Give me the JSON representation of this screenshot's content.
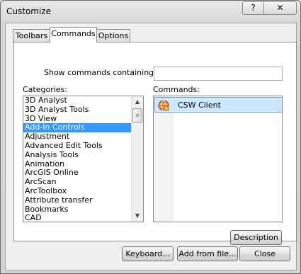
{
  "window": {
    "title": "Customize",
    "help_label": "?",
    "close_label": "✕"
  },
  "tabs": [
    {
      "label": "Toolbars",
      "active": false
    },
    {
      "label": "Commands",
      "active": true
    },
    {
      "label": "Options",
      "active": false
    }
  ],
  "search": {
    "label": "Show commands containing:",
    "value": ""
  },
  "categories": {
    "label": "Categories:",
    "items": [
      "3D Analyst",
      "3D Analyst Tools",
      "3D View",
      "Add-In Controls",
      "Adjustment",
      "Advanced Edit Tools",
      "Analysis Tools",
      "Animation",
      "ArcGIS Online",
      "ArcScan",
      "ArcToolbox",
      "Attribute transfer",
      "Bookmarks",
      "CAD"
    ],
    "selected": "Add-In Controls"
  },
  "commands": {
    "label": "Commands:",
    "items": [
      {
        "label": "CSW Client",
        "icon": "csw-client-icon"
      }
    ]
  },
  "buttons": {
    "description": "Description",
    "keyboard": "Keyboard...",
    "add_from_file": "Add from file...",
    "close": "Close"
  }
}
